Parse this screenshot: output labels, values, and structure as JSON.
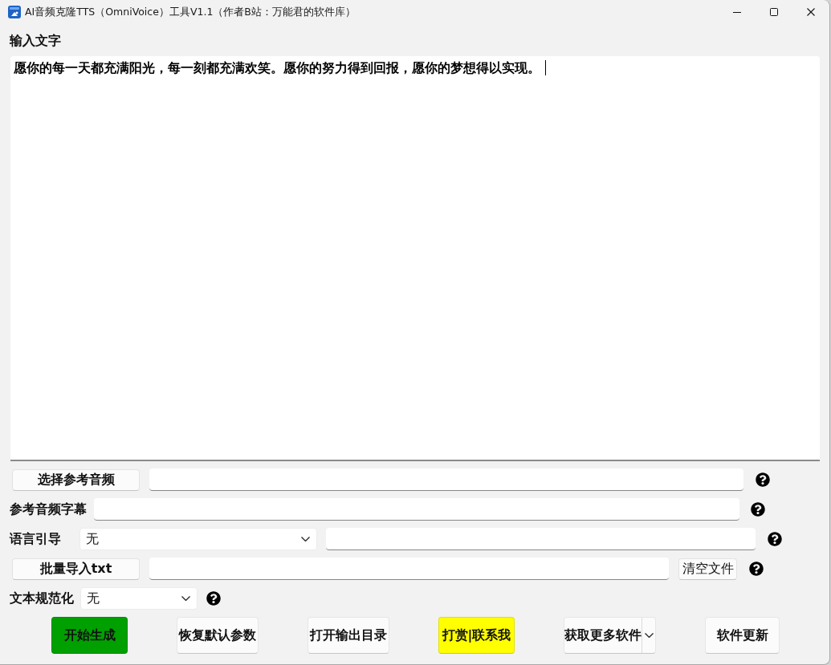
{
  "window": {
    "title": "AI音频克隆TTS（OmniVoice）工具V1.1（作者B站：万能君的软件库）"
  },
  "text_input": {
    "label": "输入文字",
    "value": "愿你的每一天都充满阳光，每一刻都充满欢笑。愿你的努力得到回报，愿你的梦想得以实现。",
    "focused": true
  },
  "form_rows": [
    {
      "items": [
        {
          "kind": "button",
          "label": "选择参考音频"
        },
        {
          "kind": "field"
        },
        {
          "kind": "help"
        }
      ]
    },
    {
      "items": [
        {
          "kind": "label",
          "label": "参考音频字幕"
        },
        {
          "kind": "field"
        },
        {
          "kind": "help"
        }
      ]
    },
    {
      "items": [
        {
          "kind": "label",
          "label": "语言引导"
        },
        {
          "kind": "select",
          "value": "无"
        },
        {
          "kind": "field"
        },
        {
          "kind": "help"
        }
      ]
    },
    {
      "items": [
        {
          "kind": "button",
          "label": "批量导入txt"
        },
        {
          "kind": "field"
        },
        {
          "kind": "small_button",
          "label": "清空文件"
        },
        {
          "kind": "help"
        }
      ]
    },
    {
      "items": [
        {
          "kind": "label",
          "label": "文本规范化"
        },
        {
          "kind": "select",
          "value": "无"
        },
        {
          "kind": "help"
        }
      ]
    }
  ],
  "buttons": [
    {
      "kind": "plain",
      "label": "开始生成",
      "color": "#00a000"
    },
    {
      "kind": "plain",
      "label": "恢复默认参数"
    },
    {
      "kind": "plain",
      "label": "打开输出目录"
    },
    {
      "kind": "plain",
      "label": "打赏|联系我",
      "color": "#ffff00"
    },
    {
      "kind": "split",
      "label": "获取更多软件"
    },
    {
      "kind": "plain",
      "label": "软件更新"
    }
  ]
}
